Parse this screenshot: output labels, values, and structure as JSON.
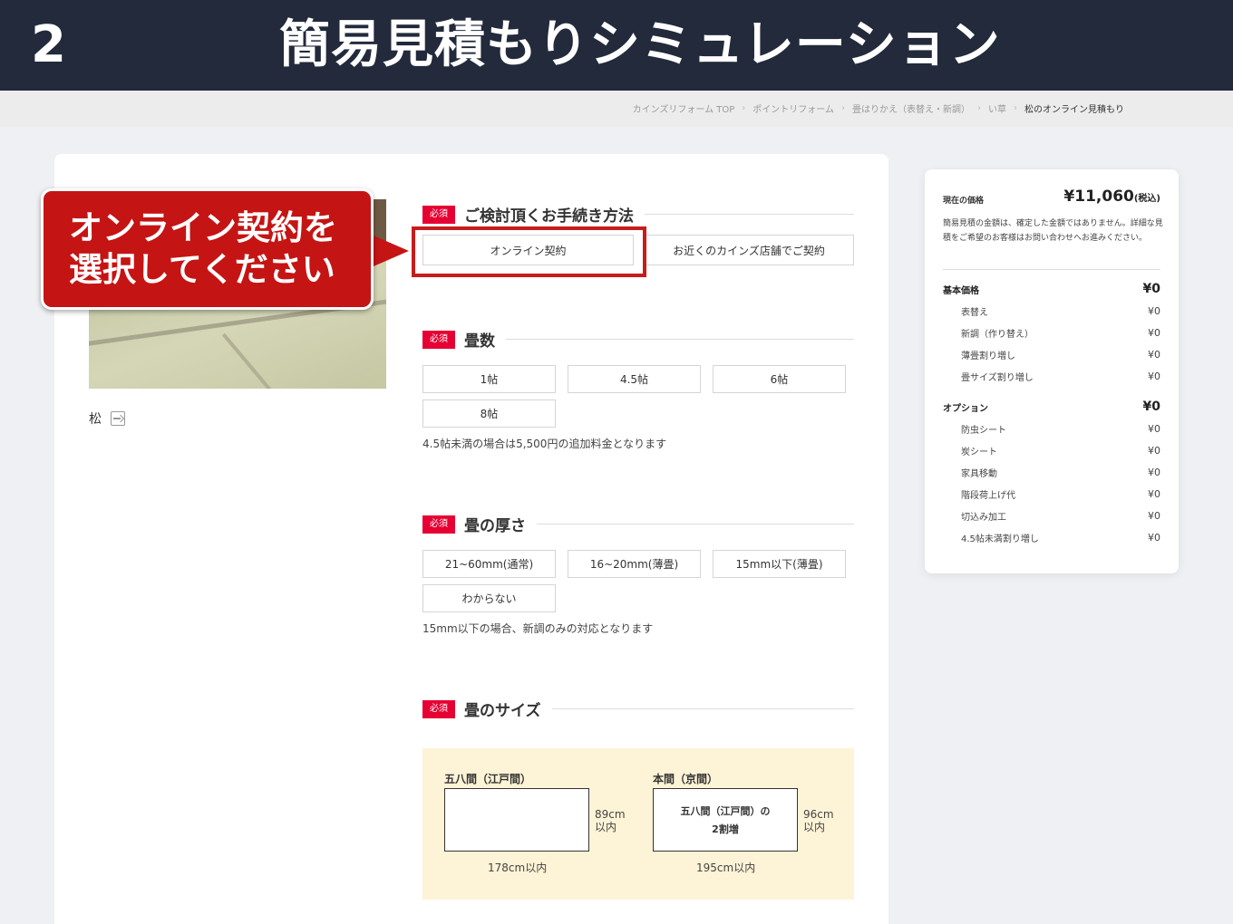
{
  "banner": {
    "step": "2",
    "title": "簡易見積もりシミュレーション"
  },
  "breadcrumb": [
    "カインズリフォーム TOP",
    "ポイントリフォーム",
    "畳はりかえ（表替え・新調）",
    "い草",
    "松のオンライン見積もり"
  ],
  "product": {
    "name": "松"
  },
  "callout": {
    "line1": "オンライン契約を",
    "line2": "選択してください"
  },
  "sections": {
    "procedure": {
      "badge": "必須",
      "title": "ご検討頂くお手続き方法",
      "options": [
        "オンライン契約",
        "お近くのカインズ店舗でご契約"
      ]
    },
    "count": {
      "badge": "必須",
      "title": "畳数",
      "options": [
        "1帖",
        "4.5帖",
        "6帖",
        "8帖"
      ],
      "note": "4.5帖未満の場合は5,500円の追加料金となります"
    },
    "thickness": {
      "badge": "必須",
      "title": "畳の厚さ",
      "options": [
        "21~60mm(通常)",
        "16~20mm(薄畳)",
        "15mm以下(薄畳)",
        "わからない"
      ],
      "note": "15mm以下の場合、新調のみの対応となります"
    },
    "size": {
      "badge": "必須",
      "title": "畳のサイズ",
      "panels": [
        {
          "label": "五八間（江戸間）",
          "inner_line1": "",
          "inner_line2": "",
          "height_line1": "89cm",
          "height_line2": "以内",
          "width": "178cm以内"
        },
        {
          "label": "本間（京間）",
          "inner_line1": "五八間（江戸間）の",
          "inner_line2": "2割増",
          "height_line1": "96cm",
          "height_line2": "以内",
          "width": "195cm以内"
        }
      ]
    }
  },
  "price_card": {
    "label": "現在の価格",
    "price": "¥11,060",
    "tax_label": "(税込)",
    "note": "簡易見積の金額は、確定した金額ではありません。詳細な見積をご希望のお客様はお問い合わせへお進みください。",
    "categories": [
      {
        "name": "基本価格",
        "value": "¥0",
        "items": [
          {
            "name": "表替え",
            "value": "¥0"
          },
          {
            "name": "新調（作り替え）",
            "value": "¥0"
          },
          {
            "name": "薄畳割り増し",
            "value": "¥0"
          },
          {
            "name": "畳サイズ割り増し",
            "value": "¥0"
          }
        ]
      },
      {
        "name": "オプション",
        "value": "¥0",
        "items": [
          {
            "name": "防虫シート",
            "value": "¥0"
          },
          {
            "name": "炭シート",
            "value": "¥0"
          },
          {
            "name": "家具移動",
            "value": "¥0"
          },
          {
            "name": "階段荷上げ代",
            "value": "¥0"
          },
          {
            "name": "切込み加工",
            "value": "¥0"
          },
          {
            "name": "4.5帖未満割り増し",
            "value": "¥0"
          }
        ]
      }
    ]
  },
  "colors": {
    "banner_bg": "#222a3b",
    "required_badge": "#e60033",
    "callout_red": "#c51414",
    "size_panel_bg": "#fdf3d6"
  }
}
